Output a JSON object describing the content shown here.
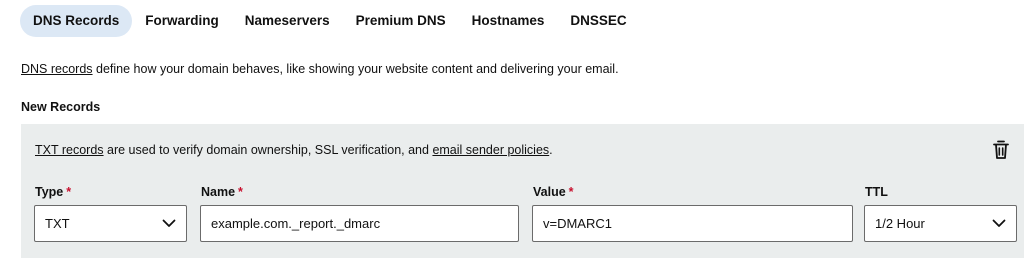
{
  "tabs": [
    {
      "label": "DNS Records",
      "active": true
    },
    {
      "label": "Forwarding",
      "active": false
    },
    {
      "label": "Nameservers",
      "active": false
    },
    {
      "label": "Premium DNS",
      "active": false
    },
    {
      "label": "Hostnames",
      "active": false
    },
    {
      "label": "DNSSEC",
      "active": false
    }
  ],
  "intro": {
    "link": "DNS records",
    "text": " define how your domain behaves, like showing your website content and delivering your email."
  },
  "new_records": {
    "title": "New Records",
    "notice": {
      "link1": "TXT records",
      "text1": " are used to verify domain ownership, SSL verification, and ",
      "link2": "email sender policies",
      "text2": "."
    },
    "fields": {
      "type": {
        "label": "Type",
        "required_mark": "*",
        "value": "TXT"
      },
      "name": {
        "label": "Name",
        "required_mark": "*",
        "value": "example.com._report._dmarc"
      },
      "value": {
        "label": "Value",
        "required_mark": "*",
        "value": "v=DMARC1"
      },
      "ttl": {
        "label": "TTL",
        "value": "1/2 Hour"
      }
    }
  },
  "icons": {
    "delete": "trash-icon",
    "dropdown": "chevron-down-icon"
  },
  "colors": {
    "active_tab_bg": "#dce8f5",
    "panel_bg": "#eaeded",
    "required": "#c8102e"
  }
}
